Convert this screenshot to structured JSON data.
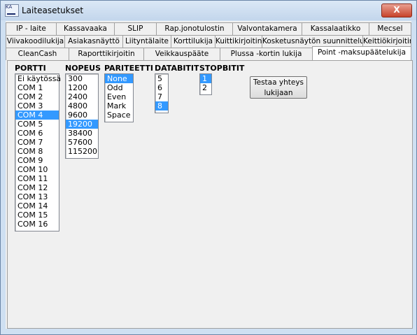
{
  "window": {
    "title": "Laiteasetukset",
    "icon_text": "KA",
    "close_symbol": "X"
  },
  "tabs": {
    "row1": [
      "IP - laite",
      "Kassavaaka",
      "SLIP",
      "Rap.jonotulostin",
      "Valvontakamera",
      "Kassalaatikko",
      "Mecsel"
    ],
    "row2": [
      "Viivakoodilukija",
      "Asiakasnäyttö",
      "Liityntälaite",
      "Korttilukija",
      "Kuittikirjoitin",
      "Kosketusnäytön suunnittelu",
      "Keittiökirjoitin"
    ],
    "row3": [
      "CleanCash",
      "Raporttikirjoitin",
      "Veikkauspääte",
      "Plussa -kortin lukija",
      "Point -maksupäätelukija"
    ],
    "active": "Point -maksupäätelukija"
  },
  "columns": {
    "portti": {
      "title": "PORTTI",
      "items": [
        "Ei käytössä",
        "COM 1",
        "COM 2",
        "COM 3",
        "COM 4",
        "COM 5",
        "COM 6",
        "COM 7",
        "COM 8",
        "COM 9",
        "COM 10",
        "COM 11",
        "COM 12",
        "COM 13",
        "COM 14",
        "COM 15",
        "COM 16"
      ],
      "selected": "COM 4"
    },
    "nopeus": {
      "title": "NOPEUS",
      "items": [
        "300",
        "1200",
        "2400",
        "4800",
        "9600",
        "19200",
        "38400",
        "57600",
        "115200"
      ],
      "selected": "19200"
    },
    "pariteetti": {
      "title": "PARITEETTI",
      "items": [
        "None",
        "Odd",
        "Even",
        "Mark",
        "Space"
      ],
      "selected": "None"
    },
    "databitit": {
      "title": "DATABITIT",
      "items": [
        "5",
        "6",
        "7",
        "8"
      ],
      "selected": "8"
    },
    "stopbitit": {
      "title": "STOPBITIT",
      "items": [
        "1",
        "2"
      ],
      "selected": "1"
    }
  },
  "test_button": {
    "line1": "Testaa yhteys",
    "line2": "lukijaan"
  },
  "colors": {
    "selection": "#3399ff",
    "title_bar": "#cfe0f2",
    "close": "#c7432b"
  }
}
